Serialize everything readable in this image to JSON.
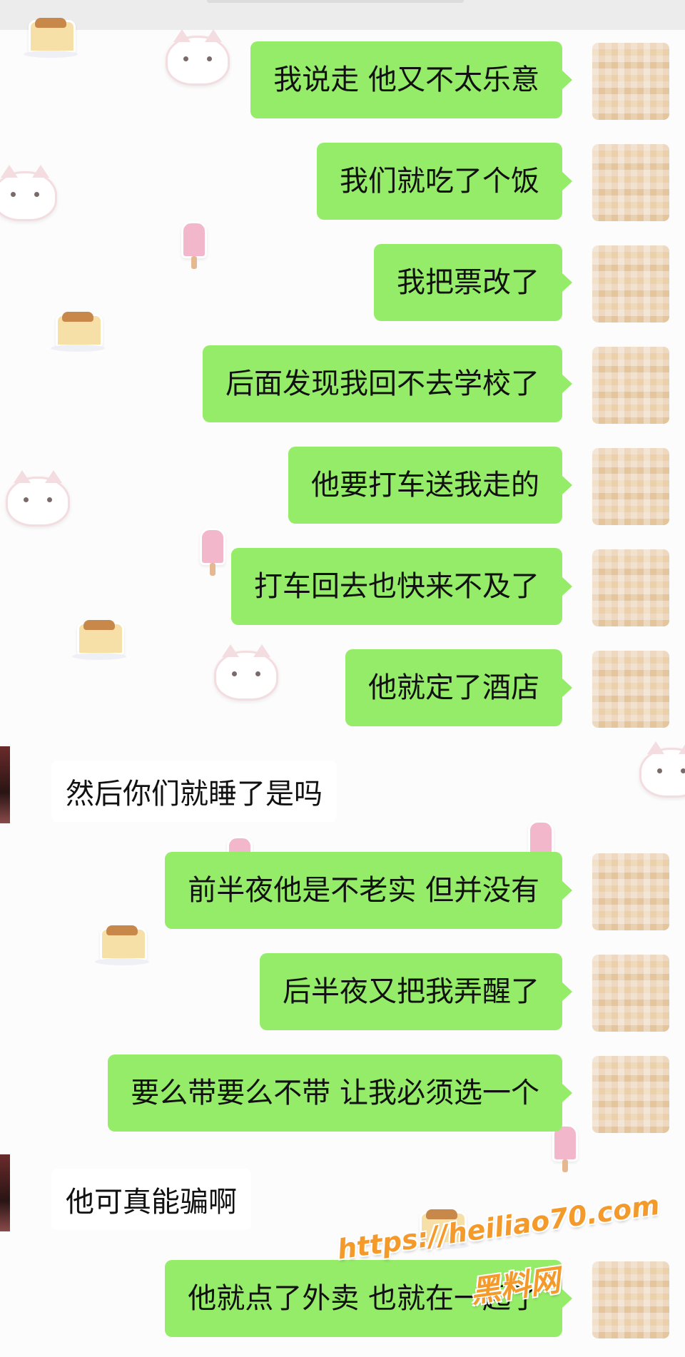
{
  "colors": {
    "outgoing_bubble": "#95ec69",
    "watermark": "#f49a2a"
  },
  "messages": [
    {
      "direction": "out",
      "text": "我说走 他又不太乐意"
    },
    {
      "direction": "out",
      "text": "我们就吃了个饭"
    },
    {
      "direction": "out",
      "text": "我把票改了"
    },
    {
      "direction": "out",
      "text": "后面发现我回不去学校了"
    },
    {
      "direction": "out",
      "text": "他要打车送我走的"
    },
    {
      "direction": "out",
      "text": "打车回去也快来不及了"
    },
    {
      "direction": "out",
      "text": "他就定了酒店"
    },
    {
      "direction": "in",
      "text": "然后你们就睡了是吗"
    },
    {
      "direction": "out",
      "text": "前半夜他是不老实 但并没有"
    },
    {
      "direction": "out",
      "text": "后半夜又把我弄醒了"
    },
    {
      "direction": "out",
      "text": "要么带要么不带 让我必须选一个"
    },
    {
      "direction": "in",
      "text": "他可真能骗啊"
    },
    {
      "direction": "out",
      "text": "他就点了外卖 也就在一起了"
    }
  ],
  "watermark": {
    "url": "https://heiliao70.com",
    "name": "黑料网"
  }
}
